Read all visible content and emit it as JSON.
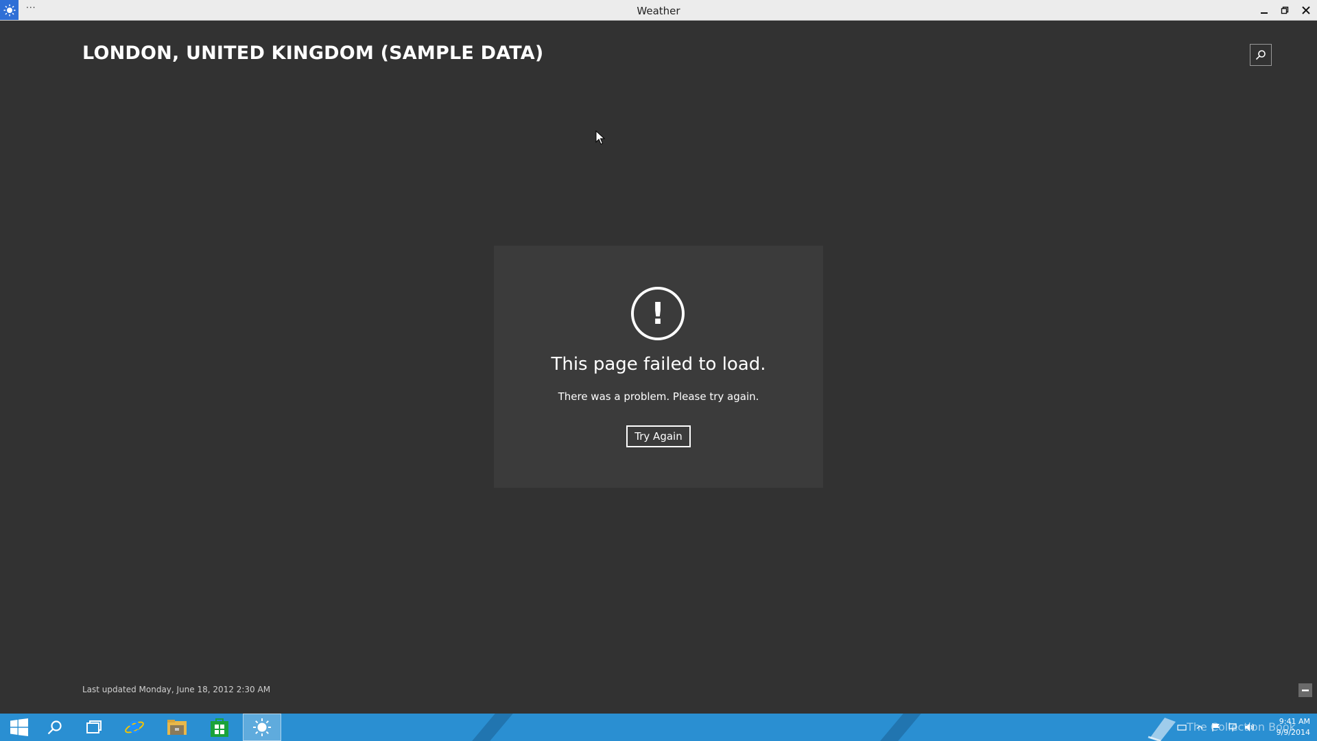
{
  "window": {
    "title": "Weather",
    "menu_dots": "···"
  },
  "header": {
    "location": "LONDON, UNITED KINGDOM (SAMPLE DATA)",
    "search_icon": "search-icon"
  },
  "error": {
    "icon": "exclamation-circle-icon",
    "title": "This page failed to load.",
    "message": "There was a problem. Please try again.",
    "button_label": "Try Again"
  },
  "footer": {
    "last_updated": "Last updated Monday, June 18, 2012 2:30 AM"
  },
  "taskbar": {
    "items": [
      "windows-start",
      "search",
      "task-view",
      "internet-explorer",
      "file-explorer",
      "store",
      "weather"
    ],
    "active_item": "weather",
    "watermark": "The Collection Book",
    "time": "9:41 AM",
    "date": "9/9/2014"
  },
  "colors": {
    "background": "#323232",
    "panel": "#3b3b3b",
    "taskbar": "#2a8fd2",
    "titlebar": "#ececec"
  }
}
